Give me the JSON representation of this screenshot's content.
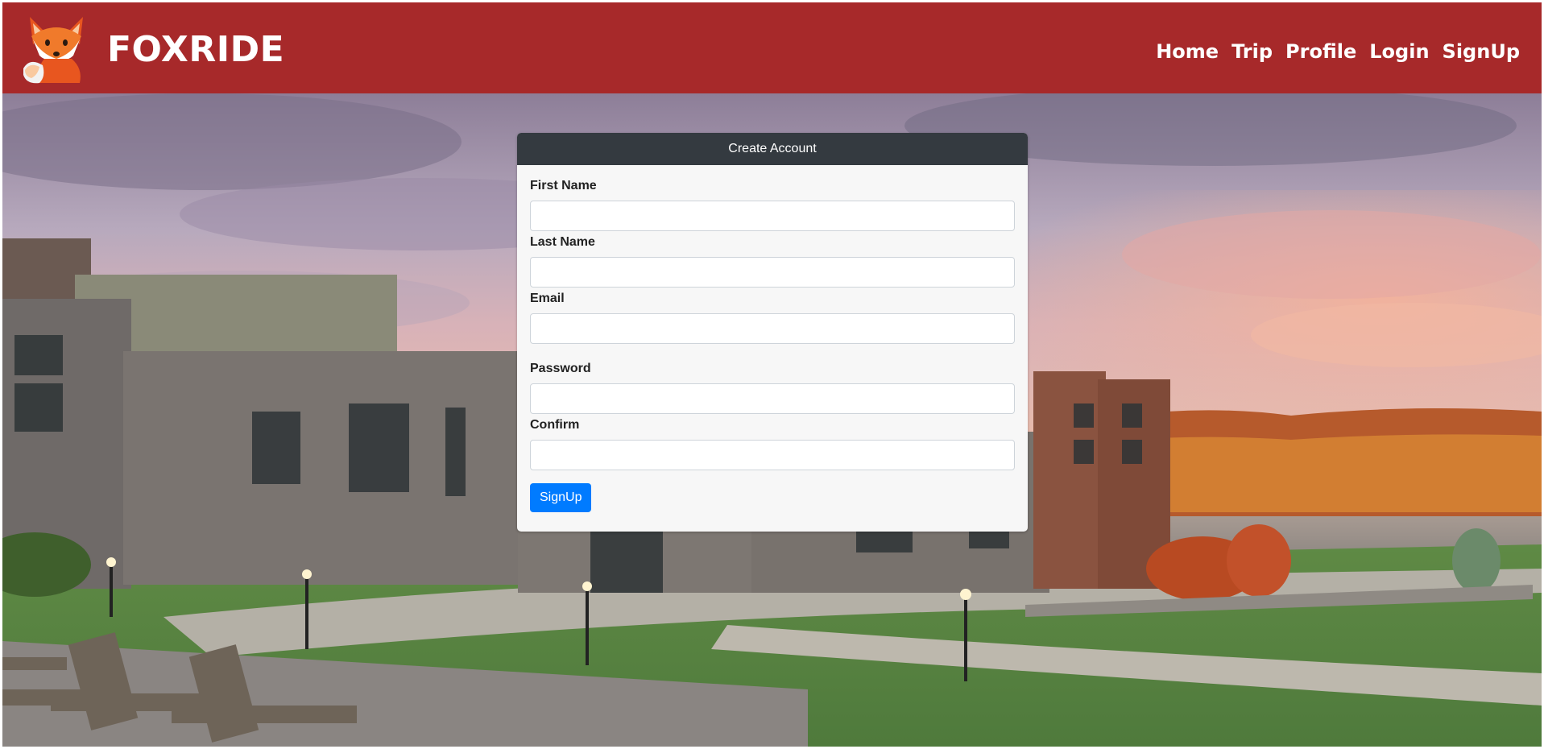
{
  "brand": {
    "name": "FOXRIDE",
    "logo_icon": "fox-logo-icon"
  },
  "nav": {
    "items": [
      {
        "label": "Home"
      },
      {
        "label": "Trip"
      },
      {
        "label": "Profile"
      },
      {
        "label": "Login"
      },
      {
        "label": "SignUp"
      }
    ]
  },
  "form": {
    "title": "Create Account",
    "fields": [
      {
        "label": "First Name",
        "value": "",
        "placeholder": ""
      },
      {
        "label": "Last Name",
        "value": "",
        "placeholder": ""
      },
      {
        "label": "Email",
        "value": "",
        "placeholder": ""
      },
      {
        "label": "Password",
        "value": "",
        "placeholder": ""
      },
      {
        "label": "Confirm",
        "value": "",
        "placeholder": ""
      }
    ],
    "submit_label": "SignUp"
  },
  "colors": {
    "navbar": "#a7292a",
    "card_header": "#343a40",
    "button": "#007bff"
  }
}
